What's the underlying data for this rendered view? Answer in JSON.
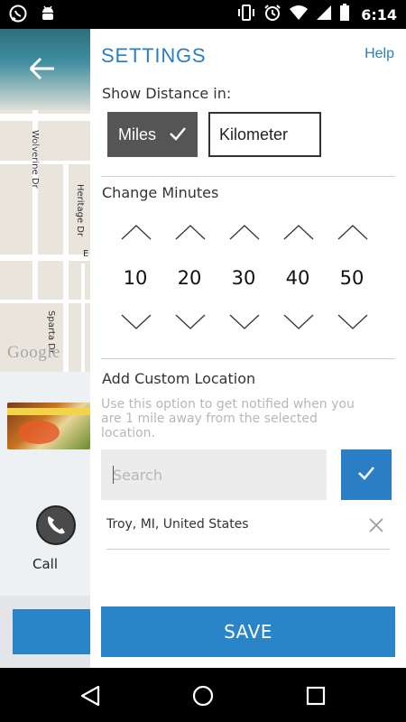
{
  "status_bar": {
    "time": "6:14",
    "icons": [
      "whatsapp-icon",
      "android-debug-icon",
      "vibrate-icon",
      "alarm-icon",
      "wifi-icon",
      "signal-icon",
      "battery-icon"
    ]
  },
  "background_app": {
    "map": {
      "streets": [
        "Wolverine Dr",
        "Heritage Dr",
        "Sparta Dr",
        "E"
      ],
      "logo": "Google"
    },
    "call_label": "Call"
  },
  "settings": {
    "title": "SETTINGS",
    "help_label": "Help",
    "distance": {
      "label": "Show Distance in:",
      "options": [
        "Miles",
        "Kilometer"
      ],
      "selected": "Miles"
    },
    "minutes": {
      "label": "Change Minutes",
      "values": [
        "10",
        "20",
        "30",
        "40",
        "50"
      ]
    },
    "custom_location": {
      "label": "Add Custom Location",
      "helper": "Use this option to get notified when you are 1 mile away from the selected location.",
      "search_placeholder": "Search",
      "locations": [
        "Troy, MI, United States"
      ]
    },
    "save_label": "SAVE"
  },
  "colors": {
    "accent": "#2a7fc4",
    "save_button": "#2a84c8",
    "selected_option": "#555555"
  }
}
